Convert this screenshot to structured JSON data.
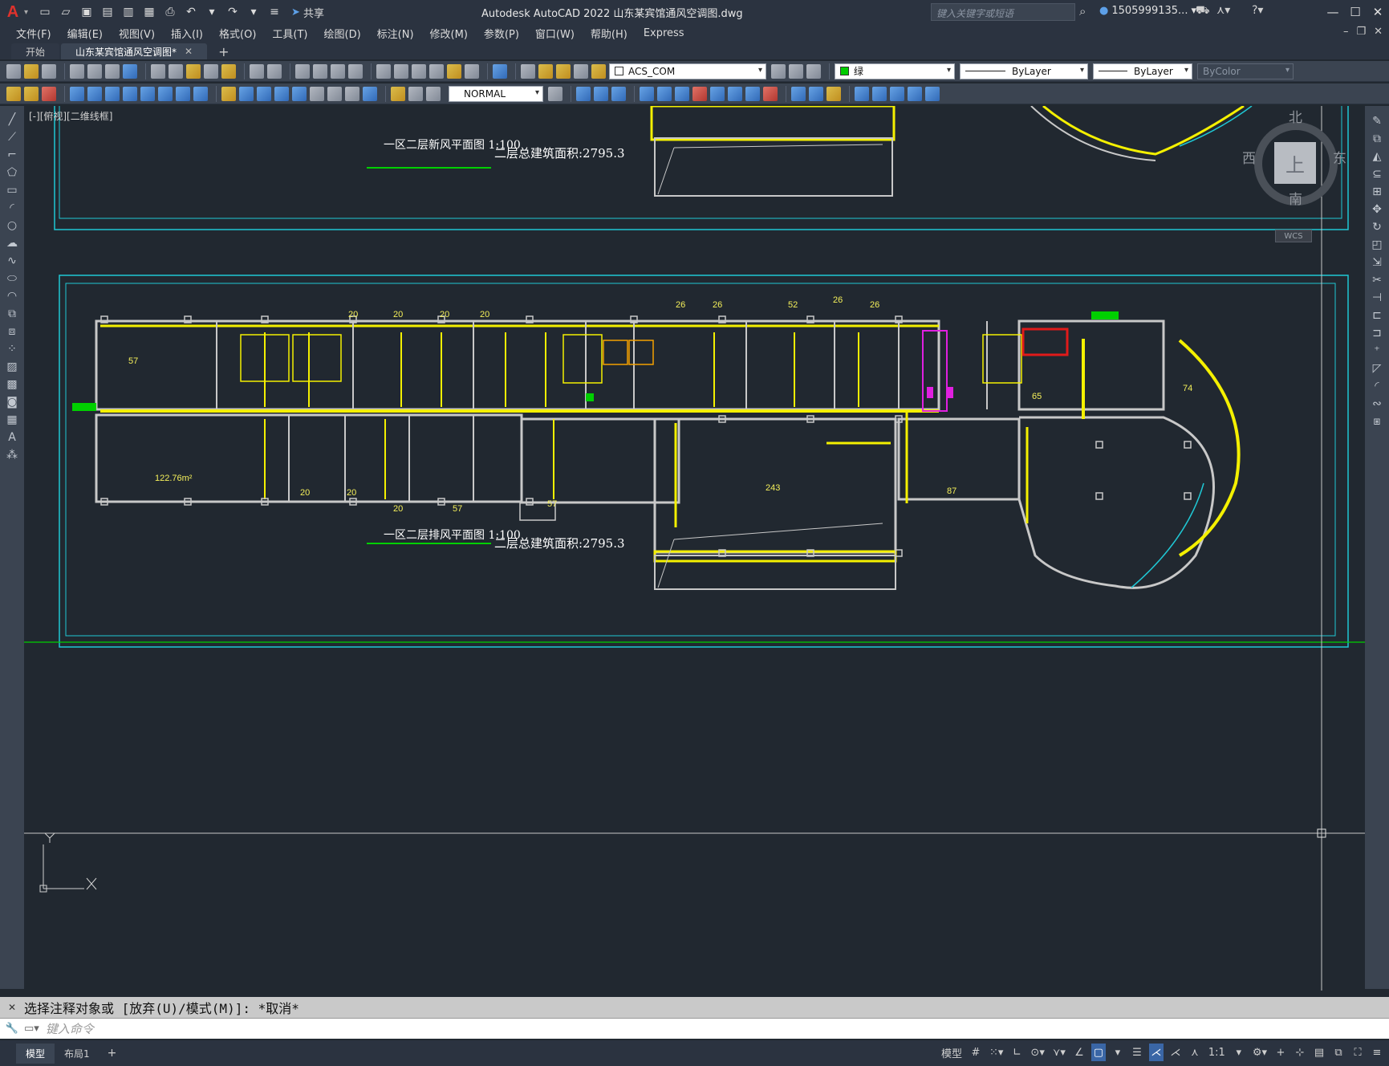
{
  "app": {
    "title": "Autodesk AutoCAD 2022    山东某宾馆通风空调图.dwg",
    "logo": "A",
    "share_label": "共享",
    "search_placeholder": "键入关键字或短语",
    "user": "1505999135...",
    "window_controls": [
      "minimize-icon",
      "maximize-icon",
      "close-icon"
    ]
  },
  "menu": {
    "items": [
      "文件(F)",
      "编辑(E)",
      "视图(V)",
      "插入(I)",
      "格式(O)",
      "工具(T)",
      "绘图(D)",
      "标注(N)",
      "修改(M)",
      "参数(P)",
      "窗口(W)",
      "帮助(H)",
      "Express"
    ]
  },
  "tabs": {
    "items": [
      {
        "label": "开始",
        "active": false
      },
      {
        "label": "山东某宾馆通风空调图*",
        "active": true
      }
    ],
    "add": "+"
  },
  "properties": {
    "layer": "ACS_COM",
    "color": "绿",
    "color_hex": "#00cc00",
    "linetype": "ByLayer",
    "lineweight": "ByLayer",
    "plotstyle": "ByColor",
    "text_style": "NORMAL"
  },
  "viewport": {
    "label": "[-][俯视][二维线框]"
  },
  "viewcube": {
    "north": "北",
    "south": "南",
    "east": "东",
    "west": "西",
    "top": "上",
    "wcs": "WCS"
  },
  "drawing": {
    "title_top": "一区二层新风平面图 1:100",
    "area_top": "二层总建筑面积:2795.3",
    "title_bottom": "一区二层排风平面图 1:100",
    "area_bottom": "二层总建筑面积:2795.3",
    "room_numbers": [
      "20",
      "20",
      "20",
      "20",
      "26",
      "26",
      "52",
      "26",
      "26",
      "57",
      "65",
      "74",
      "243",
      "87",
      "20",
      "20",
      "20",
      "57",
      "57",
      "122.76m²"
    ]
  },
  "command": {
    "history": "选择注释对象或 [放弃(U)/模式(M)]: *取消*",
    "placeholder": "键入命令"
  },
  "layouts": {
    "items": [
      {
        "label": "模型",
        "active": true
      },
      {
        "label": "布局1",
        "active": false
      }
    ],
    "add": "+"
  },
  "status": {
    "model_label": "模型",
    "scale": "1:1"
  },
  "colors": {
    "background": "#212830",
    "chrome": "#2b3340",
    "toolbar": "#3b4451",
    "frame": "#1fc7d4",
    "duct": "#f4f000",
    "wall": "#c8c8c8",
    "accent_green": "#00d000",
    "magenta": "#e020e0",
    "red": "#e01a1a"
  }
}
